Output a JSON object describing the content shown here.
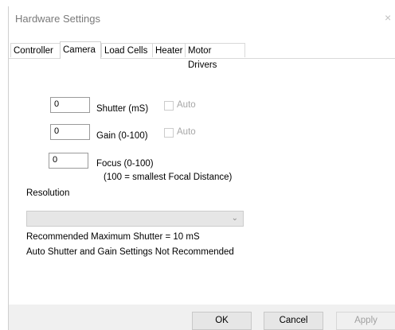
{
  "window": {
    "title": "Hardware Settings",
    "close_glyph": "×"
  },
  "tabs": [
    {
      "label": "Controller",
      "active": false
    },
    {
      "label": "Camera",
      "active": true
    },
    {
      "label": "Load Cells",
      "active": false
    },
    {
      "label": "Heater",
      "active": false
    },
    {
      "label": "Motor Drivers",
      "active": false
    }
  ],
  "camera": {
    "shutter": {
      "value": "0",
      "label": "Shutter (mS)",
      "auto_label": "Auto",
      "auto_checked": false
    },
    "gain": {
      "value": "0",
      "label": "Gain (0-100)",
      "auto_label": "Auto",
      "auto_checked": false
    },
    "focus": {
      "value": "0",
      "label": "Focus (0-100)",
      "hint": "(100 = smallest Focal Distance)"
    },
    "resolution": {
      "label": "Resolution",
      "selected": ""
    },
    "notes": [
      "Recommended Maximum Shutter = 10 mS",
      "Auto Shutter and Gain Settings Not Recommended"
    ]
  },
  "buttons": {
    "ok": "OK",
    "cancel": "Cancel",
    "apply": "Apply"
  },
  "icons": {
    "dropdown": "chevron-down-icon",
    "close": "close-icon"
  }
}
